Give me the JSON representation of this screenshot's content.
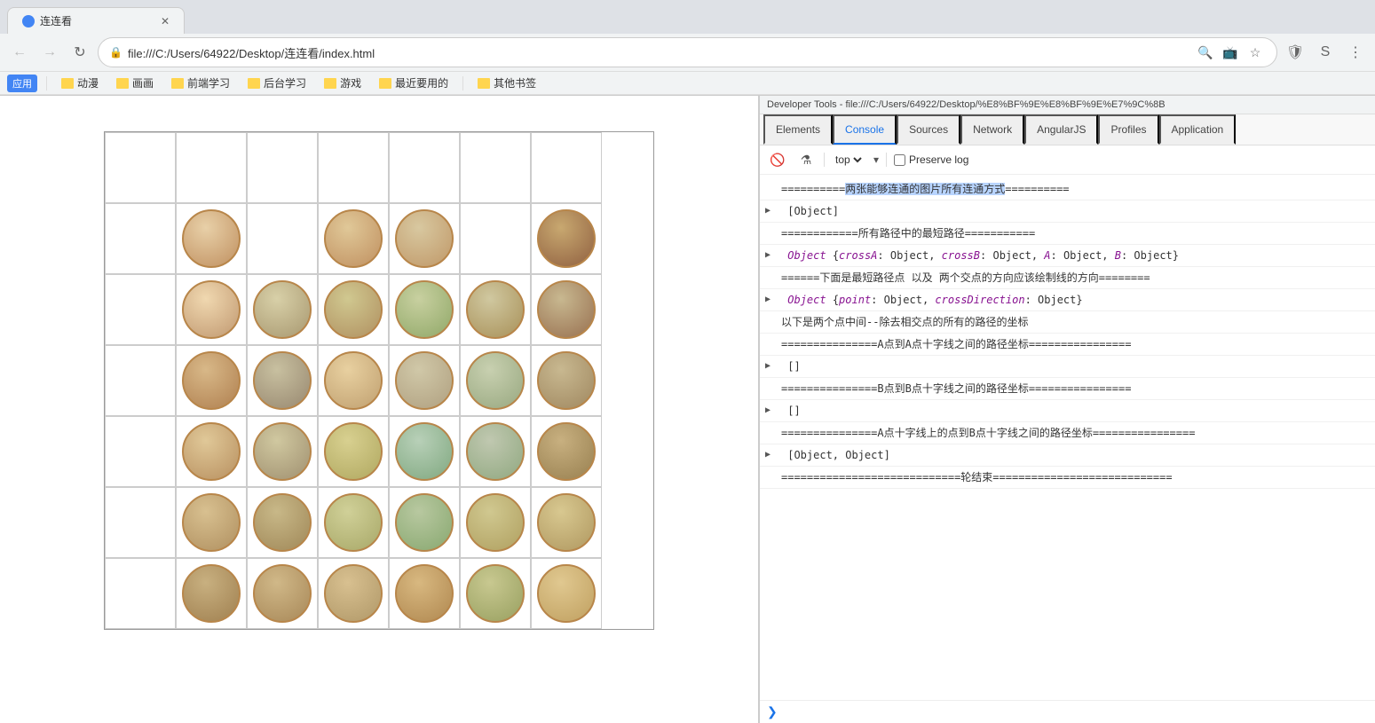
{
  "browser": {
    "tab_title": "连连看",
    "address": "file:///C:/Users/64922/Desktop/连连看/index.html",
    "back_btn": "←",
    "forward_btn": "→",
    "reload_btn": "↻",
    "bookmarks": [
      "应用",
      "动漫",
      "画画",
      "前端学习",
      "后台学习",
      "游戏",
      "最近要用的",
      "其他书签"
    ]
  },
  "devtools": {
    "title": "Developer Tools - file:///C:/Users/64922/Desktop/%E8%BF%9E%E8%BF%9E%E7%9C%8B",
    "tabs": [
      "Elements",
      "Console",
      "Sources",
      "Network",
      "AngularJS",
      "Profiles",
      "Application"
    ],
    "active_tab": "Console",
    "toolbar": {
      "top_label": "top",
      "preserve_log": "Preserve log"
    },
    "console_lines": [
      {
        "id": 1,
        "type": "separator",
        "text": "==========两张能够连通的图片所有连通方式=========="
      },
      {
        "id": 2,
        "type": "expandable",
        "text": "▶ [Object]",
        "arrow": true
      },
      {
        "id": 3,
        "type": "separator",
        "text": "============所有路径中的最短路径==========="
      },
      {
        "id": 4,
        "type": "expandable",
        "text": "▶ Object {crossA: Object, crossB: Object, A: Object, B: Object}",
        "arrow": true
      },
      {
        "id": 5,
        "type": "separator",
        "text": "======下面是最短路径点 以及 两个交点的方向应该绘制线的方向========"
      },
      {
        "id": 6,
        "type": "expandable",
        "text": "▶ Object {point: Object, crossDirection: Object}",
        "arrow": true
      },
      {
        "id": 7,
        "type": "normal",
        "text": "以下是两个点中间--除去相交点的所有的路径的坐标"
      },
      {
        "id": 8,
        "type": "separator",
        "text": "===============A点到A点十字线之间的路径坐标================"
      },
      {
        "id": 9,
        "type": "expandable",
        "text": "▶ []",
        "arrow": true
      },
      {
        "id": 10,
        "type": "separator",
        "text": "===============B点到B点十字线之间的路径坐标================"
      },
      {
        "id": 11,
        "type": "expandable",
        "text": "▶ []",
        "arrow": true
      },
      {
        "id": 12,
        "type": "separator",
        "text": "===============A点十字线上的点到B点十字线之间的路径坐标================"
      },
      {
        "id": 13,
        "type": "expandable",
        "text": "▶ [Object, Object]",
        "arrow": true
      },
      {
        "id": 14,
        "type": "separator",
        "text": "============================轮结束============================"
      }
    ]
  },
  "grid": {
    "rows": 7,
    "cols": 7,
    "cells": [
      [
        0,
        0,
        0,
        0,
        0,
        0,
        0
      ],
      [
        0,
        1,
        0,
        2,
        3,
        0,
        4
      ],
      [
        0,
        5,
        6,
        7,
        8,
        9,
        10
      ],
      [
        0,
        11,
        12,
        13,
        14,
        15,
        16
      ],
      [
        0,
        17,
        18,
        19,
        20,
        21,
        22
      ],
      [
        0,
        23,
        24,
        25,
        26,
        27,
        28
      ],
      [
        0,
        29,
        30,
        31,
        32,
        33,
        34
      ]
    ]
  }
}
